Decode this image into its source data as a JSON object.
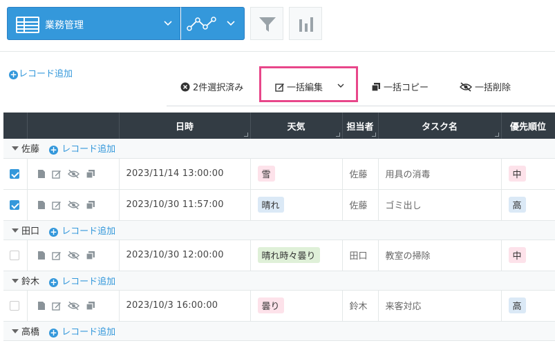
{
  "app": {
    "view_name": "業務管理"
  },
  "toolbar": {
    "add_record": "レコード追加",
    "selected": "2件選択済み",
    "bulk_edit": "一括編集",
    "bulk_copy": "一括コピー",
    "bulk_delete": "一括削除"
  },
  "table": {
    "headers": [
      "日時",
      "天気",
      "担当者",
      "タスク名",
      "優先順位"
    ],
    "group_add_label": "レコード追加",
    "groups": [
      {
        "name": "佐藤",
        "rows": [
          {
            "checked": true,
            "datetime": "2023/11/14 13:00:00",
            "weather": "雪",
            "weather_color": "#fde2ea",
            "person": "佐藤",
            "task": "用具の消毒",
            "priority": "中",
            "priority_color": "#fde2ea"
          },
          {
            "checked": true,
            "datetime": "2023/10/30 11:57:00",
            "weather": "晴れ",
            "weather_color": "#dbe9f6",
            "person": "佐藤",
            "task": "ゴミ出し",
            "priority": "高",
            "priority_color": "#dbe9f6"
          }
        ]
      },
      {
        "name": "田口",
        "rows": [
          {
            "checked": false,
            "datetime": "2023/10/30 12:00:00",
            "weather": "晴れ時々曇り",
            "weather_color": "#dff0d8",
            "person": "田口",
            "task": "教室の掃除",
            "priority": "中",
            "priority_color": "#fde2ea"
          }
        ]
      },
      {
        "name": "鈴木",
        "rows": [
          {
            "checked": false,
            "datetime": "2023/10/3 16:00:00",
            "weather": "曇り",
            "weather_color": "#fde2ea",
            "person": "鈴木",
            "task": "来客対応",
            "priority": "高",
            "priority_color": "#dbe9f6"
          }
        ]
      },
      {
        "name": "高橋",
        "rows": []
      }
    ]
  },
  "colors": {
    "accent": "#3498db",
    "header_bg": "#333c44",
    "highlight": "#e8468a"
  },
  "icons": [
    "table-icon",
    "graph-icon",
    "filter-icon",
    "bar-chart-icon",
    "plus-circle-icon",
    "close-circle-icon",
    "edit-icon",
    "copy-icon",
    "eye-off-icon",
    "document-icon",
    "chevron-down-icon"
  ]
}
